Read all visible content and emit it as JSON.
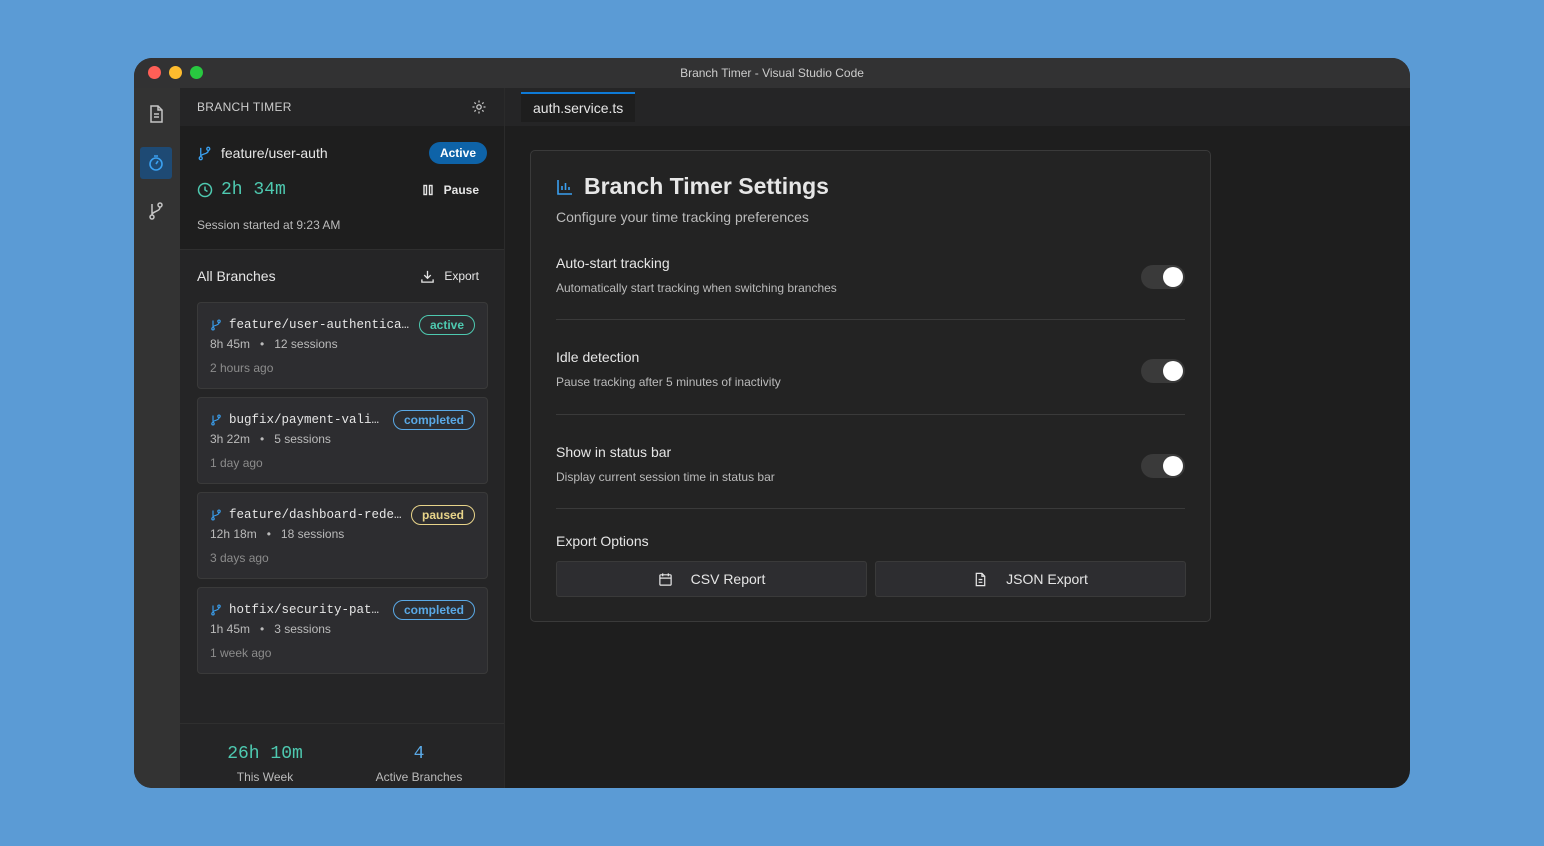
{
  "window": {
    "title": "Branch Timer - Visual Studio Code"
  },
  "sidebar": {
    "title": "BRANCH TIMER",
    "current": {
      "branch": "feature/user-auth",
      "status": "Active",
      "elapsed": "2h 34m",
      "pause_label": "Pause",
      "session_started": "Session started at 9:23 AM"
    },
    "all_branches_title": "All Branches",
    "export_label": "Export",
    "branches": [
      {
        "name": "feature/user-authentication",
        "status": "active",
        "time": "8h 45m",
        "sessions": "12 sessions",
        "ago": "2 hours ago"
      },
      {
        "name": "bugfix/payment-validation",
        "status": "completed",
        "time": "3h 22m",
        "sessions": "5 sessions",
        "ago": "1 day ago"
      },
      {
        "name": "feature/dashboard-redesign",
        "status": "paused",
        "time": "12h 18m",
        "sessions": "18 sessions",
        "ago": "3 days ago"
      },
      {
        "name": "hotfix/security-patch",
        "status": "completed",
        "time": "1h 45m",
        "sessions": "3 sessions",
        "ago": "1 week ago"
      }
    ],
    "separator": "•",
    "summary": {
      "week_total": "26h 10m",
      "week_label": "This Week",
      "active_count": "4",
      "active_label": "Active Branches"
    }
  },
  "editor": {
    "tab": "auth.service.ts"
  },
  "settings": {
    "title": "Branch Timer Settings",
    "subtitle": "Configure your time tracking preferences",
    "options": [
      {
        "title": "Auto-start tracking",
        "desc": "Automatically start tracking when switching branches",
        "enabled": true
      },
      {
        "title": "Idle detection",
        "desc": "Pause tracking after 5 minutes of inactivity",
        "enabled": true
      },
      {
        "title": "Show in status bar",
        "desc": "Display current session time in status bar",
        "enabled": true
      }
    ],
    "export_title": "Export Options",
    "csv_label": "CSV Report",
    "json_label": "JSON Export"
  },
  "colors": {
    "accent": "#0e7ad6",
    "active_badge": "#0e63a8",
    "timer": "#4ec9b0",
    "completed": "#5aa9e6",
    "paused": "#e8d48a"
  },
  "icons": [
    "files-icon",
    "timer-icon",
    "source-control-icon",
    "gear-icon",
    "branch-icon",
    "clock-icon",
    "pause-icon",
    "download-icon",
    "chart-icon",
    "calendar-icon",
    "document-icon"
  ]
}
